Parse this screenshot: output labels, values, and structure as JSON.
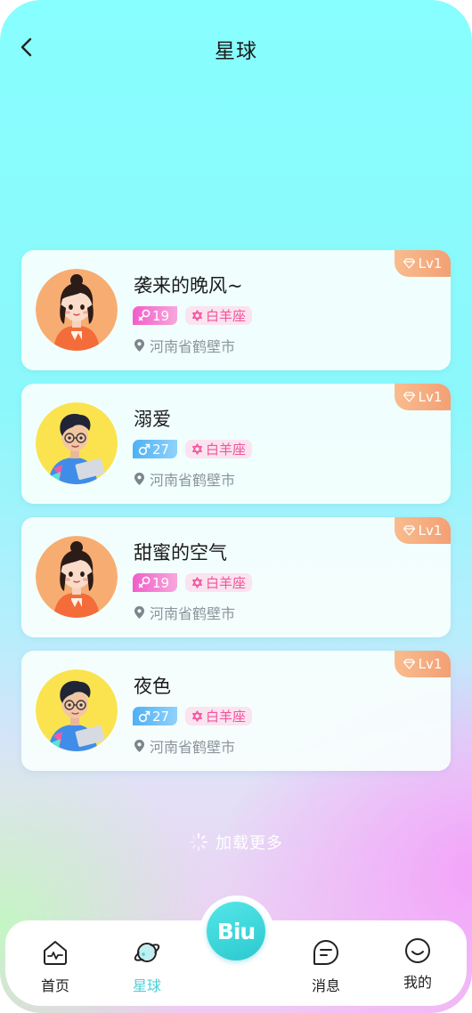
{
  "nav": {
    "title": "星球"
  },
  "cards": [
    {
      "name": "袭来的晚风~",
      "gender": "female",
      "age": "19",
      "zodiac": "白羊座",
      "location": "河南省鹤壁市",
      "level": "Lv1",
      "avatar": "girl-avatar"
    },
    {
      "name": "溺爱",
      "gender": "male",
      "age": "27",
      "zodiac": "白羊座",
      "location": "河南省鹤壁市",
      "level": "Lv1",
      "avatar": "boy-avatar"
    },
    {
      "name": "甜蜜的空气",
      "gender": "female",
      "age": "19",
      "zodiac": "白羊座",
      "location": "河南省鹤壁市",
      "level": "Lv1",
      "avatar": "girl-avatar"
    },
    {
      "name": "夜色",
      "gender": "male",
      "age": "27",
      "zodiac": "白羊座",
      "location": "河南省鹤壁市",
      "level": "Lv1",
      "avatar": "boy-avatar"
    }
  ],
  "load_more": "加载更多",
  "tabbar": {
    "items": [
      {
        "label": "首页",
        "icon": "home-icon",
        "active": false
      },
      {
        "label": "星球",
        "icon": "planet-icon",
        "active": true
      },
      {
        "label": "消息",
        "icon": "message-icon",
        "active": false
      },
      {
        "label": "我的",
        "icon": "profile-icon",
        "active": false
      }
    ],
    "center_label": "Biu"
  },
  "colors": {
    "accent": "#4bd1d7",
    "level_badge": "#f3a074",
    "female_tag": "#f25dc9",
    "male_tag": "#4fb0f5",
    "zodiac_text": "#f0559c"
  }
}
